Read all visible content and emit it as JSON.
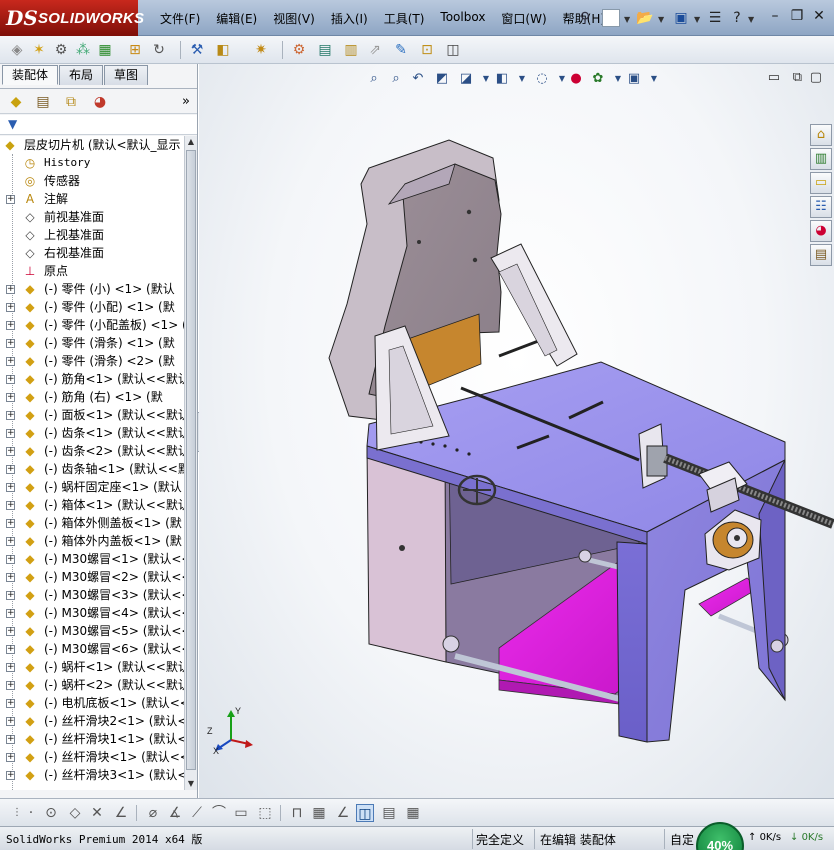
{
  "app": {
    "logo_mark": "DS",
    "logo_word": "SOLIDWORKS"
  },
  "menu": [
    "文件(F)",
    "编辑(E)",
    "视图(V)",
    "插入(I)",
    "工具(T)",
    "Toolbox",
    "窗口(W)",
    "帮助(H)"
  ],
  "panel": {
    "tabs": [
      "装配体",
      "布局",
      "草图"
    ],
    "active_tab": "装配体",
    "more_glyph": "»"
  },
  "tree": {
    "root": "层皮切片机  (默认<默认_显示",
    "items": [
      {
        "label": "History",
        "icon": "history-icon",
        "expand": false,
        "mono": true
      },
      {
        "label": "传感器",
        "icon": "sensor-icon",
        "expand": false
      },
      {
        "label": "注解",
        "icon": "annotation-icon",
        "expand": true
      },
      {
        "label": "前视基准面",
        "icon": "plane-icon",
        "expand": false
      },
      {
        "label": "上视基准面",
        "icon": "plane-icon",
        "expand": false
      },
      {
        "label": "右视基准面",
        "icon": "plane-icon",
        "expand": false
      },
      {
        "label": "原点",
        "icon": "origin-icon",
        "expand": false
      },
      {
        "label": "(-) 零件 (小) <1> (默认",
        "icon": "part-icon",
        "expand": true
      },
      {
        "label": "(-) 零件 (小配) <1> (默",
        "icon": "part-icon",
        "expand": true
      },
      {
        "label": "(-) 零件 (小配盖板) <1> (",
        "icon": "part-icon",
        "expand": true
      },
      {
        "label": "(-) 零件 (滑条) <1> (默",
        "icon": "part-icon",
        "expand": true
      },
      {
        "label": "(-) 零件 (滑条) <2> (默",
        "icon": "part-icon",
        "expand": true
      },
      {
        "label": "(-) 筋角<1> (默认<<默认",
        "icon": "part-icon",
        "expand": true
      },
      {
        "label": "(-) 筋角 (右) <1> (默",
        "icon": "part-icon",
        "expand": true
      },
      {
        "label": "(-) 面板<1> (默认<<默认",
        "icon": "part-icon",
        "expand": true
      },
      {
        "label": "(-) 齿条<1> (默认<<默认",
        "icon": "part-icon",
        "expand": true
      },
      {
        "label": "(-) 齿条<2> (默认<<默认",
        "icon": "part-icon",
        "expand": true
      },
      {
        "label": "(-) 齿条轴<1> (默认<<默",
        "icon": "part-icon",
        "expand": true
      },
      {
        "label": "(-) 蜗杆固定座<1> (默认",
        "icon": "part-icon",
        "expand": true
      },
      {
        "label": "(-) 箱体<1> (默认<<默认",
        "icon": "part-icon",
        "expand": true
      },
      {
        "label": "(-) 箱体外侧盖板<1> (默",
        "icon": "part-icon",
        "expand": true
      },
      {
        "label": "(-) 箱体外内盖板<1> (默",
        "icon": "part-icon",
        "expand": true
      },
      {
        "label": "(-) M30螺冒<1> (默认<<默",
        "icon": "part-icon",
        "expand": true
      },
      {
        "label": "(-) M30螺冒<2> (默认<<默",
        "icon": "part-icon",
        "expand": true
      },
      {
        "label": "(-) M30螺冒<3> (默认<<默",
        "icon": "part-icon",
        "expand": true
      },
      {
        "label": "(-) M30螺冒<4> (默认<<默",
        "icon": "part-icon",
        "expand": true
      },
      {
        "label": "(-) M30螺冒<5> (默认<<默",
        "icon": "part-icon",
        "expand": true
      },
      {
        "label": "(-) M30螺冒<6> (默认<<默",
        "icon": "part-icon",
        "expand": true
      },
      {
        "label": "(-) 蜗杆<1> (默认<<默认",
        "icon": "part-icon",
        "expand": true
      },
      {
        "label": "(-) 蜗杆<2> (默认<<默认",
        "icon": "part-icon",
        "expand": true
      },
      {
        "label": "(-) 电机底板<1> (默认<<",
        "icon": "part-icon",
        "expand": true
      },
      {
        "label": "(-) 丝杆滑块2<1> (默认<",
        "icon": "part-icon",
        "expand": true
      },
      {
        "label": "(-) 丝杆滑块1<1> (默认<",
        "icon": "part-icon",
        "expand": true
      },
      {
        "label": "(-) 丝杆滑块<1> (默认<<",
        "icon": "part-icon",
        "expand": true
      },
      {
        "label": "(-) 丝杆滑块3<1> (默认<",
        "icon": "part-icon",
        "expand": true
      }
    ]
  },
  "triad": {
    "x": "X",
    "y": "Y",
    "z": "Z"
  },
  "status": {
    "product": "SolidWorks Premium 2014 x64 版",
    "definition": "完全定义",
    "mode": "在编辑 装配体",
    "custom": "自定",
    "net_percent": "40%",
    "up_speed": "0K/s",
    "down_speed": "0K/s"
  },
  "colors": {
    "body_purple": "#8f86e0",
    "top_purple": "#a29af0",
    "magenta_slide": "#e022e0",
    "brown_plate": "#c6862e",
    "gray_panel": "#9c8f98",
    "accent_green": "#0a7a36"
  }
}
